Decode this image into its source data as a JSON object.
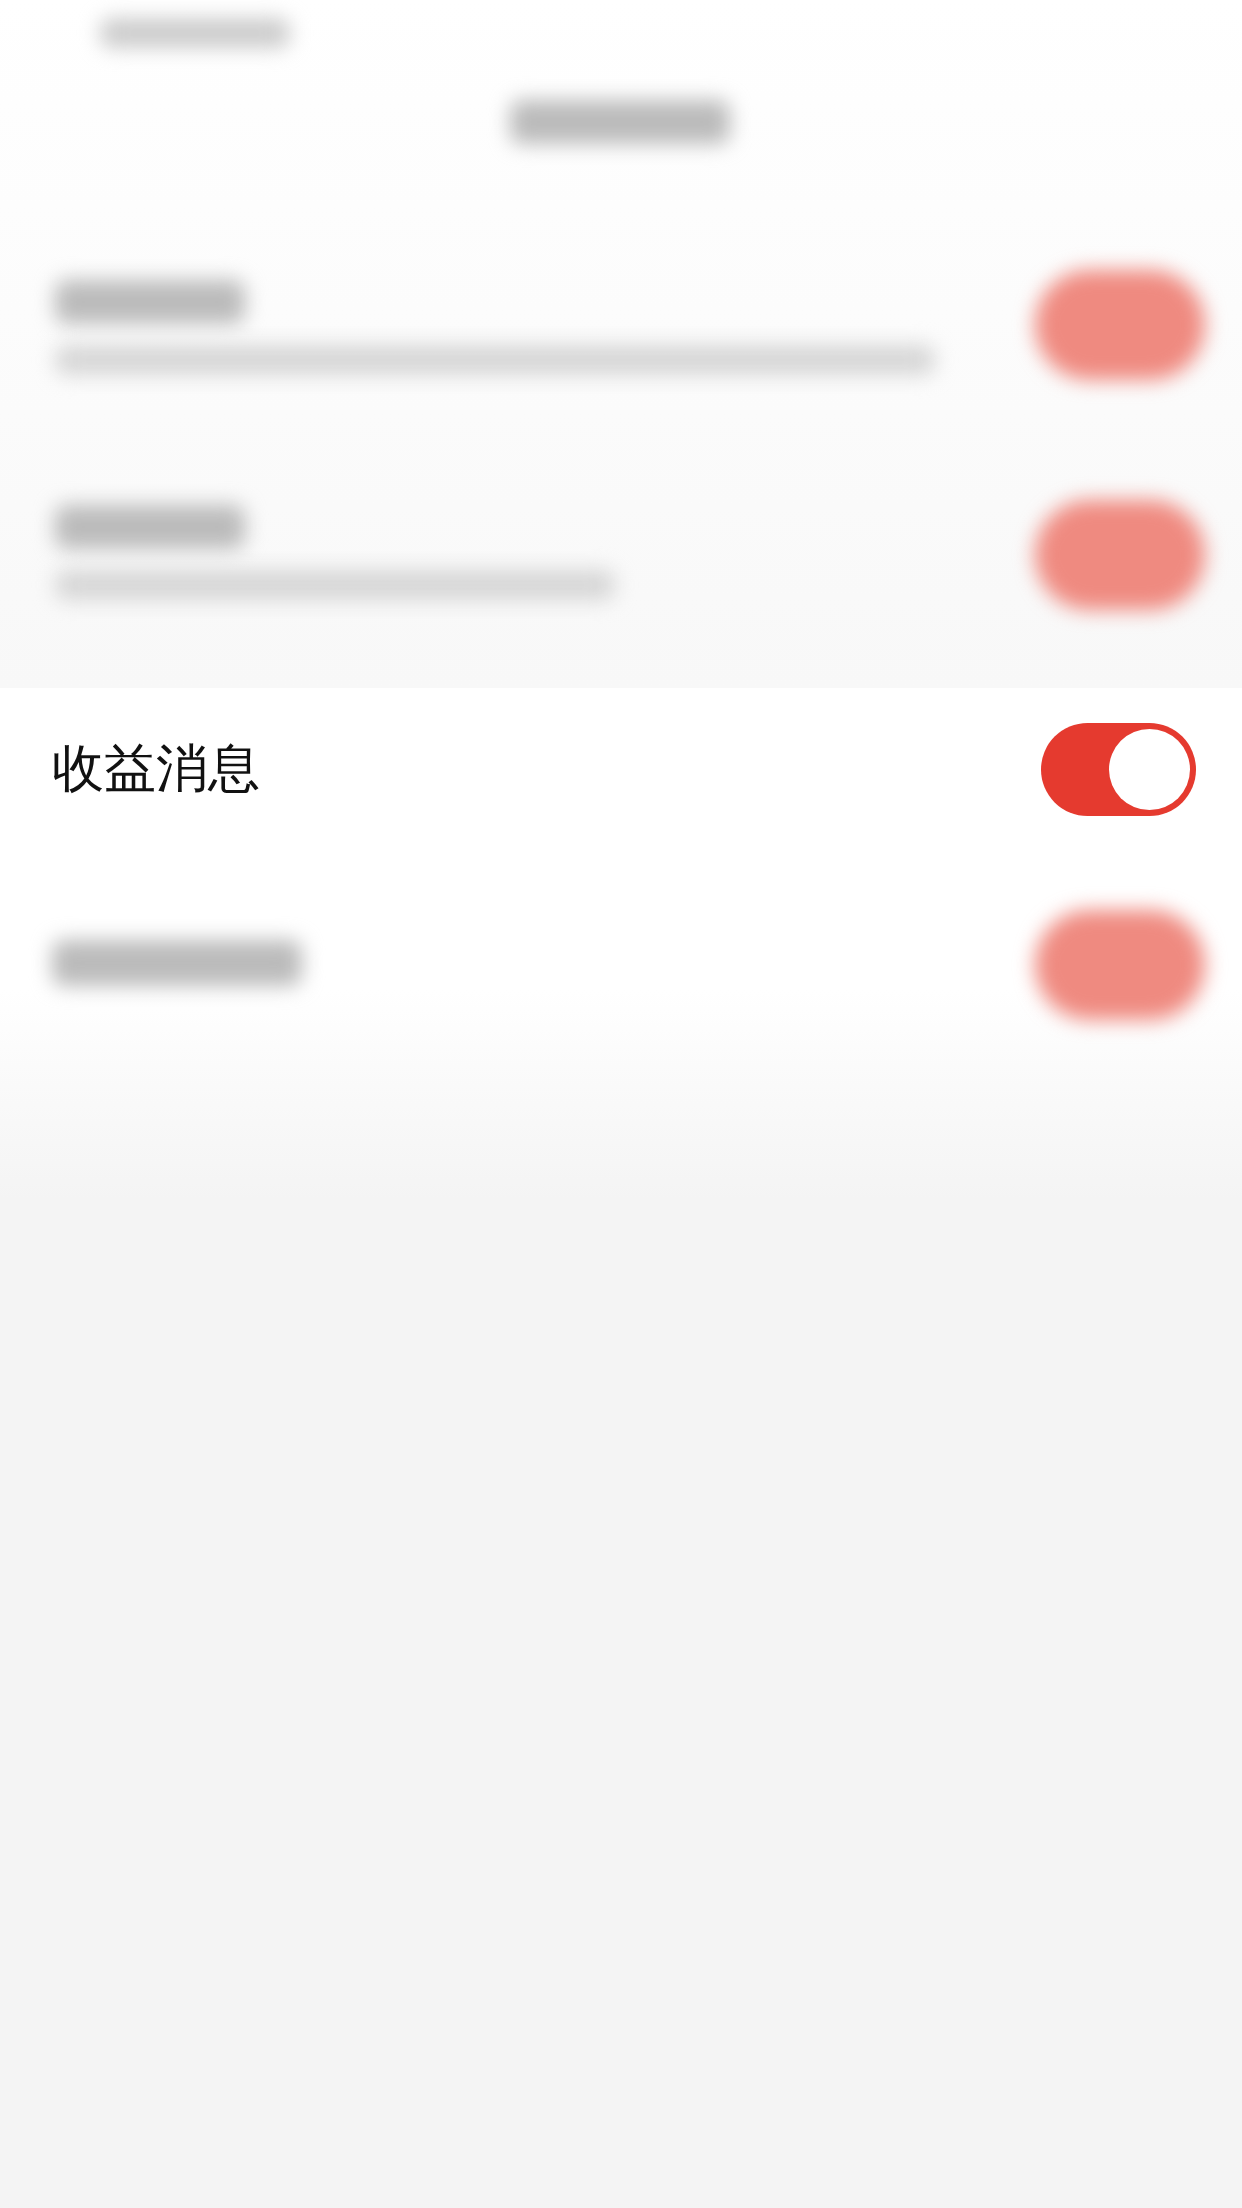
{
  "setting_row": {
    "label": "收益消息",
    "toggle": {
      "on": true
    }
  }
}
